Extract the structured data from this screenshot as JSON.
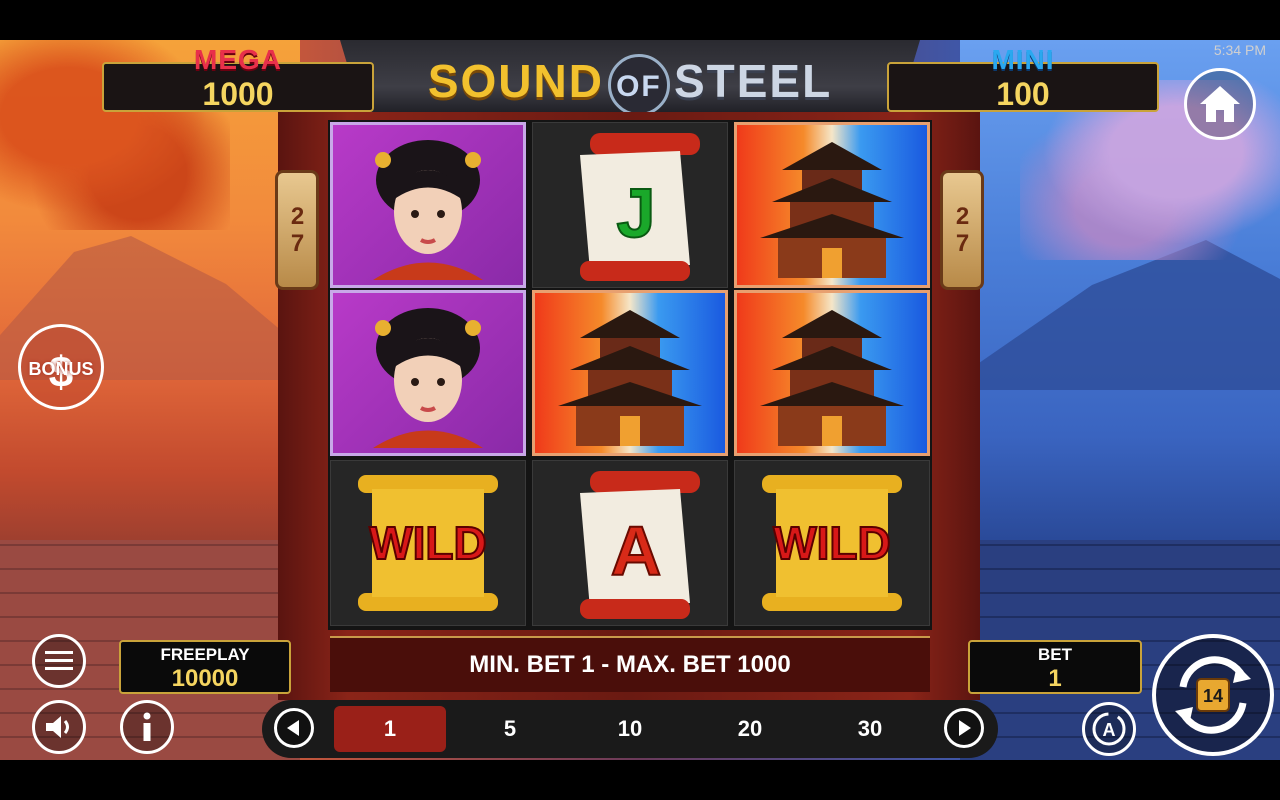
{
  "status": {
    "time": "5:34 PM"
  },
  "header": {
    "title_word1": "SOUND",
    "title_word2": "OF",
    "title_word3": "STEEL"
  },
  "jackpots": {
    "mega": {
      "label": "MEGA",
      "value": "1000"
    },
    "mini": {
      "label": "MINI",
      "value": "100"
    }
  },
  "side_counters": {
    "left": "27",
    "right": "27"
  },
  "bonus": {
    "label": "BONUS",
    "symbol": "$"
  },
  "reels": [
    [
      "geisha",
      "geisha",
      "wild"
    ],
    [
      "scroll-j",
      "pagoda",
      "scroll-a"
    ],
    [
      "pagoda",
      "pagoda",
      "wild"
    ]
  ],
  "symbol_text": {
    "wild": "WILD",
    "scroll_j": "J",
    "scroll_a": "A"
  },
  "bet_info": "MIN. BET 1 - MAX. BET 1000",
  "freeplay": {
    "label": "FREEPLAY",
    "value": "10000"
  },
  "bet": {
    "label": "BET",
    "value": "1"
  },
  "bet_options": [
    "1",
    "5",
    "10",
    "20",
    "30"
  ],
  "selected_bet_index": 0,
  "autoplay_label": "A",
  "spin_icon_text": "14",
  "colors": {
    "gold": "#c9a33a",
    "mega": "#e8304a",
    "mini": "#2aa8f0",
    "selected": "#9a2018"
  },
  "icons": [
    "home-icon",
    "menu-icon",
    "sound-icon",
    "info-icon",
    "chevron-left-icon",
    "chevron-right-icon",
    "autoplay-icon",
    "spin-icon",
    "bell-icon"
  ]
}
